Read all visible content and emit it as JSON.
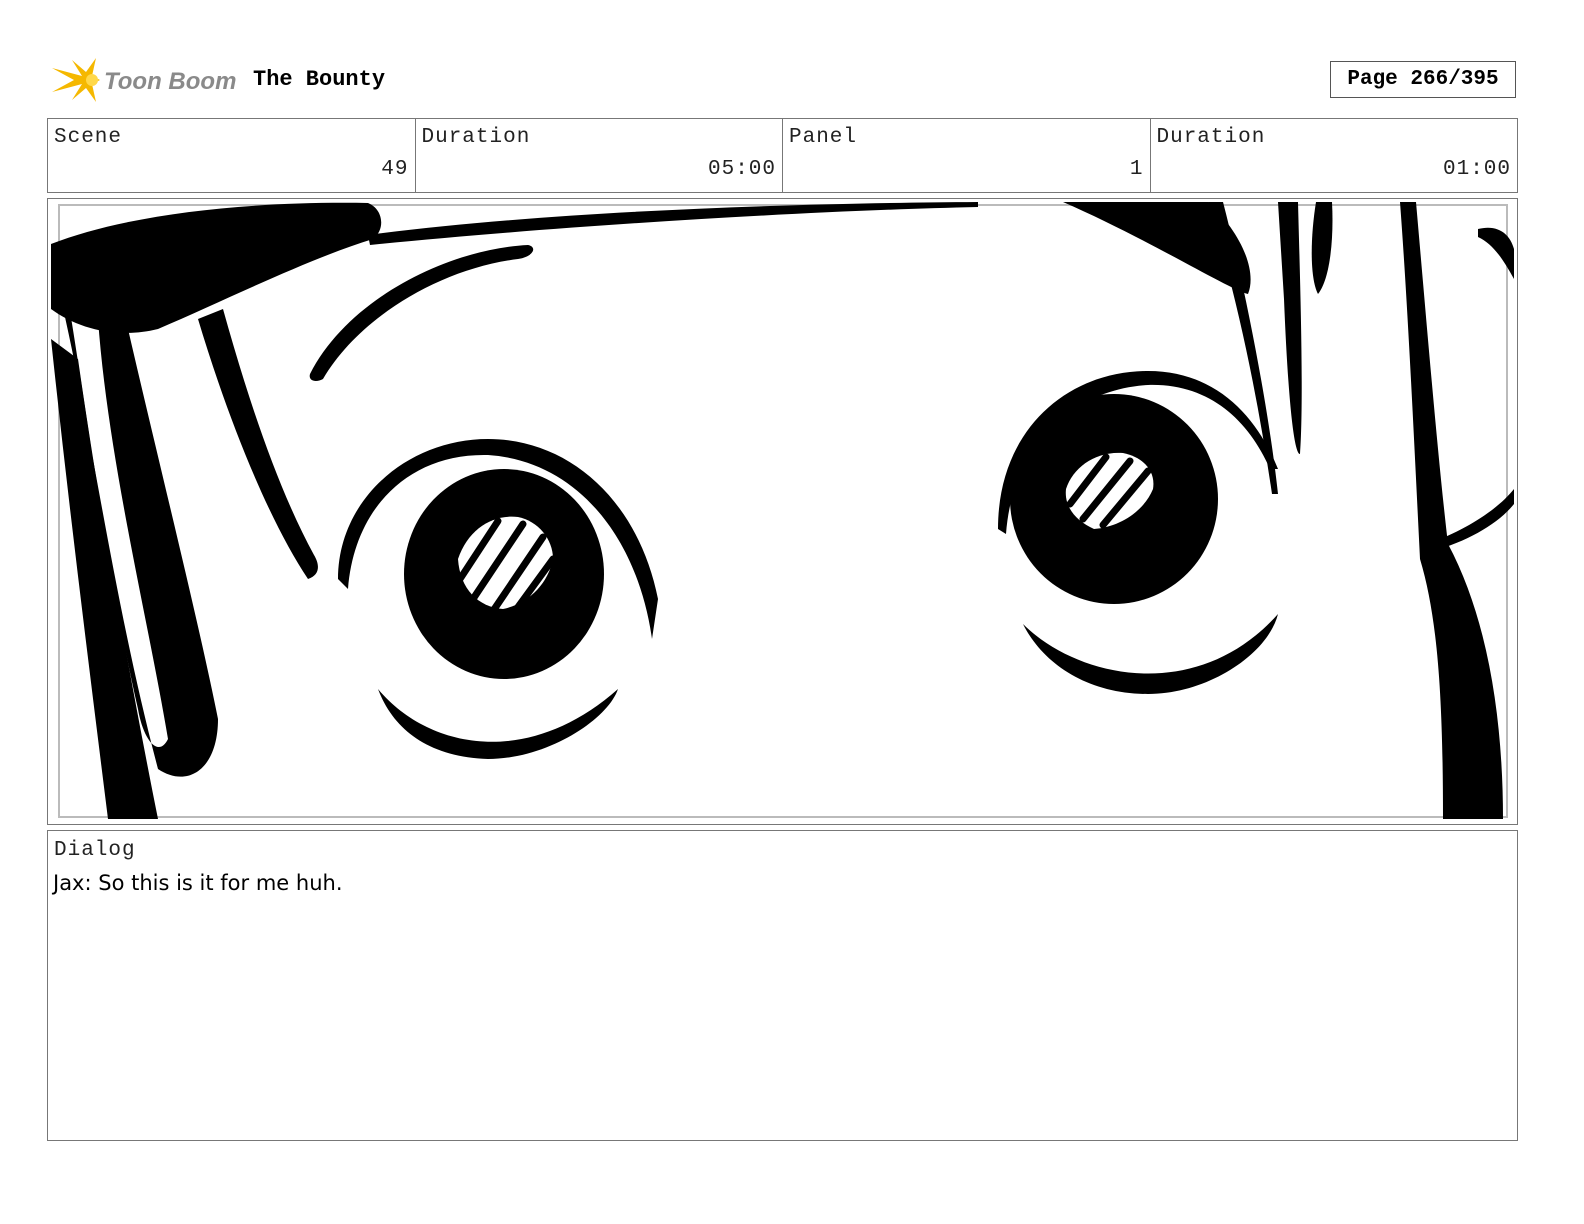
{
  "header": {
    "logo_text": "Toon Boom",
    "project_title": "The Bounty",
    "page_label": "Page 266/395"
  },
  "info": {
    "scene_label": "Scene",
    "scene_value": "49",
    "scene_duration_label": "Duration",
    "scene_duration_value": "05:00",
    "panel_label": "Panel",
    "panel_value": "1",
    "panel_duration_label": "Duration",
    "panel_duration_value": "01:00"
  },
  "dialog": {
    "label": "Dialog",
    "text": "Jax: So this is it for me huh."
  },
  "colors": {
    "logo_accent": "#f5b800",
    "logo_text": "#8a8a8a",
    "border": "#777777",
    "ink": "#000000"
  }
}
